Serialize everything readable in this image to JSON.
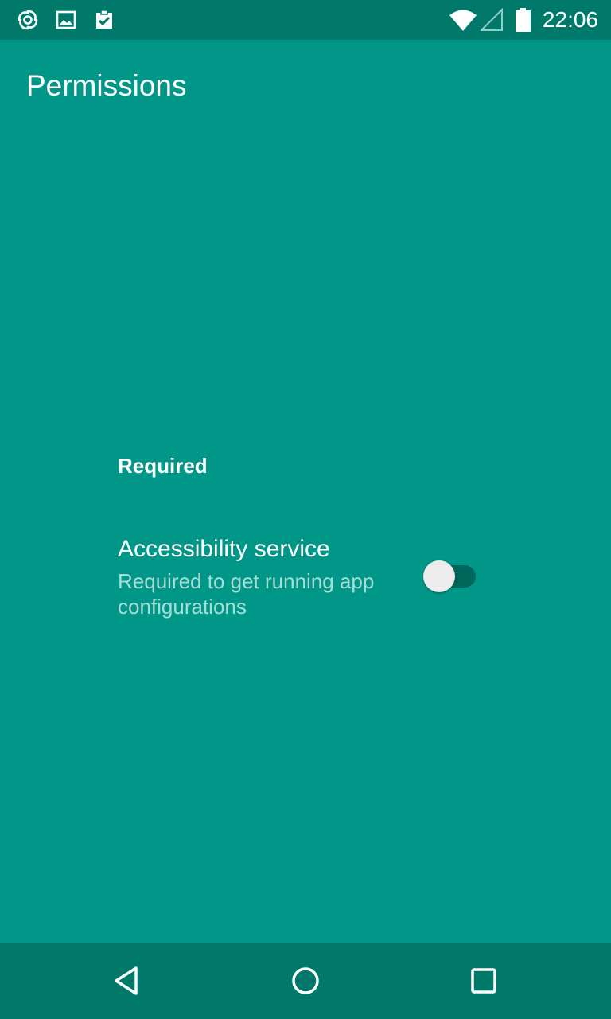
{
  "status_bar": {
    "time": "22:06",
    "icons_left": [
      "sync-spiral-icon",
      "image-icon",
      "clipboard-check-icon"
    ],
    "icons_right": [
      "wifi-icon",
      "cell-signal-icon",
      "battery-icon"
    ]
  },
  "app_bar": {
    "title": "Permissions"
  },
  "section": {
    "header": "Required",
    "items": [
      {
        "title": "Accessibility service",
        "summary": "Required to get running app configurations",
        "switch_on": false
      }
    ]
  },
  "nav_bar": {
    "buttons": [
      "back-icon",
      "home-icon",
      "recents-icon"
    ]
  },
  "colors": {
    "background": "#009788",
    "status_bar": "#00796b",
    "nav_bar": "#00796b",
    "summary_text": "#a7ddd6",
    "switch_track": "#00675c",
    "switch_thumb": "#ececec"
  }
}
